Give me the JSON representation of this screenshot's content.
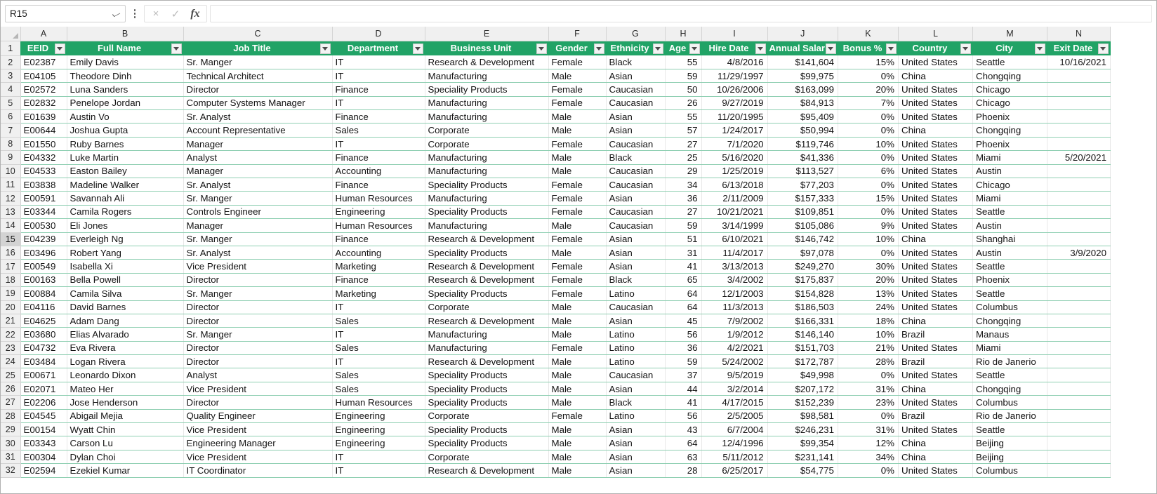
{
  "app": {
    "title": "Excel Worksheet",
    "accent_color": "#21a366",
    "header_text_color": "#ffffff",
    "gridline_color": "#8fcfb2"
  },
  "formula_bar": {
    "name_box_value": "R15",
    "name_box_caret": "chevron-down-icon",
    "more_icon": "kebab-menu-icon",
    "cancel_icon": "×",
    "confirm_icon": "✓",
    "function_icon": "fx",
    "formula_value": ""
  },
  "grid": {
    "column_letters": [
      "A",
      "B",
      "C",
      "D",
      "E",
      "F",
      "G",
      "H",
      "I",
      "J",
      "K",
      "L",
      "M",
      "N"
    ],
    "header_row_number": "1",
    "selected_row": "15",
    "headers": [
      "EEID",
      "Full Name",
      "Job Title",
      "Department",
      "Business Unit",
      "Gender",
      "Ethnicity",
      "Age",
      "Hire Date",
      "Annual Salar",
      "Bonus %",
      "Country",
      "City",
      "Exit Date"
    ],
    "row_numbers": [
      "2",
      "3",
      "4",
      "5",
      "6",
      "7",
      "8",
      "9",
      "10",
      "11",
      "12",
      "13",
      "14",
      "15",
      "16",
      "17",
      "18",
      "19",
      "20",
      "21",
      "22",
      "23",
      "24",
      "25",
      "26",
      "27",
      "28",
      "29",
      "30",
      "31",
      "32"
    ],
    "rows": [
      [
        "E02387",
        "Emily Davis",
        "Sr. Manger",
        "IT",
        "Research & Development",
        "Female",
        "Black",
        "55",
        "4/8/2016",
        "$141,604",
        "15%",
        "United States",
        "Seattle",
        "10/16/2021"
      ],
      [
        "E04105",
        "Theodore Dinh",
        "Technical Architect",
        "IT",
        "Manufacturing",
        "Male",
        "Asian",
        "59",
        "11/29/1997",
        "$99,975",
        "0%",
        "China",
        "Chongqing",
        ""
      ],
      [
        "E02572",
        "Luna Sanders",
        "Director",
        "Finance",
        "Speciality Products",
        "Female",
        "Caucasian",
        "50",
        "10/26/2006",
        "$163,099",
        "20%",
        "United States",
        "Chicago",
        ""
      ],
      [
        "E02832",
        "Penelope Jordan",
        "Computer Systems Manager",
        "IT",
        "Manufacturing",
        "Female",
        "Caucasian",
        "26",
        "9/27/2019",
        "$84,913",
        "7%",
        "United States",
        "Chicago",
        ""
      ],
      [
        "E01639",
        "Austin Vo",
        "Sr. Analyst",
        "Finance",
        "Manufacturing",
        "Male",
        "Asian",
        "55",
        "11/20/1995",
        "$95,409",
        "0%",
        "United States",
        "Phoenix",
        ""
      ],
      [
        "E00644",
        "Joshua Gupta",
        "Account Representative",
        "Sales",
        "Corporate",
        "Male",
        "Asian",
        "57",
        "1/24/2017",
        "$50,994",
        "0%",
        "China",
        "Chongqing",
        ""
      ],
      [
        "E01550",
        "Ruby Barnes",
        "Manager",
        "IT",
        "Corporate",
        "Female",
        "Caucasian",
        "27",
        "7/1/2020",
        "$119,746",
        "10%",
        "United States",
        "Phoenix",
        ""
      ],
      [
        "E04332",
        "Luke Martin",
        "Analyst",
        "Finance",
        "Manufacturing",
        "Male",
        "Black",
        "25",
        "5/16/2020",
        "$41,336",
        "0%",
        "United States",
        "Miami",
        "5/20/2021"
      ],
      [
        "E04533",
        "Easton Bailey",
        "Manager",
        "Accounting",
        "Manufacturing",
        "Male",
        "Caucasian",
        "29",
        "1/25/2019",
        "$113,527",
        "6%",
        "United States",
        "Austin",
        ""
      ],
      [
        "E03838",
        "Madeline Walker",
        "Sr. Analyst",
        "Finance",
        "Speciality Products",
        "Female",
        "Caucasian",
        "34",
        "6/13/2018",
        "$77,203",
        "0%",
        "United States",
        "Chicago",
        ""
      ],
      [
        "E00591",
        "Savannah Ali",
        "Sr. Manger",
        "Human Resources",
        "Manufacturing",
        "Female",
        "Asian",
        "36",
        "2/11/2009",
        "$157,333",
        "15%",
        "United States",
        "Miami",
        ""
      ],
      [
        "E03344",
        "Camila Rogers",
        "Controls Engineer",
        "Engineering",
        "Speciality Products",
        "Female",
        "Caucasian",
        "27",
        "10/21/2021",
        "$109,851",
        "0%",
        "United States",
        "Seattle",
        ""
      ],
      [
        "E00530",
        "Eli Jones",
        "Manager",
        "Human Resources",
        "Manufacturing",
        "Male",
        "Caucasian",
        "59",
        "3/14/1999",
        "$105,086",
        "9%",
        "United States",
        "Austin",
        ""
      ],
      [
        "E04239",
        "Everleigh Ng",
        "Sr. Manger",
        "Finance",
        "Research & Development",
        "Female",
        "Asian",
        "51",
        "6/10/2021",
        "$146,742",
        "10%",
        "China",
        "Shanghai",
        ""
      ],
      [
        "E03496",
        "Robert Yang",
        "Sr. Analyst",
        "Accounting",
        "Speciality Products",
        "Male",
        "Asian",
        "31",
        "11/4/2017",
        "$97,078",
        "0%",
        "United States",
        "Austin",
        "3/9/2020"
      ],
      [
        "E00549",
        "Isabella Xi",
        "Vice President",
        "Marketing",
        "Research & Development",
        "Female",
        "Asian",
        "41",
        "3/13/2013",
        "$249,270",
        "30%",
        "United States",
        "Seattle",
        ""
      ],
      [
        "E00163",
        "Bella Powell",
        "Director",
        "Finance",
        "Research & Development",
        "Female",
        "Black",
        "65",
        "3/4/2002",
        "$175,837",
        "20%",
        "United States",
        "Phoenix",
        ""
      ],
      [
        "E00884",
        "Camila Silva",
        "Sr. Manger",
        "Marketing",
        "Speciality Products",
        "Female",
        "Latino",
        "64",
        "12/1/2003",
        "$154,828",
        "13%",
        "United States",
        "Seattle",
        ""
      ],
      [
        "E04116",
        "David Barnes",
        "Director",
        "IT",
        "Corporate",
        "Male",
        "Caucasian",
        "64",
        "11/3/2013",
        "$186,503",
        "24%",
        "United States",
        "Columbus",
        ""
      ],
      [
        "E04625",
        "Adam Dang",
        "Director",
        "Sales",
        "Research & Development",
        "Male",
        "Asian",
        "45",
        "7/9/2002",
        "$166,331",
        "18%",
        "China",
        "Chongqing",
        ""
      ],
      [
        "E03680",
        "Elias Alvarado",
        "Sr. Manger",
        "IT",
        "Manufacturing",
        "Male",
        "Latino",
        "56",
        "1/9/2012",
        "$146,140",
        "10%",
        "Brazil",
        "Manaus",
        ""
      ],
      [
        "E04732",
        "Eva Rivera",
        "Director",
        "Sales",
        "Manufacturing",
        "Female",
        "Latino",
        "36",
        "4/2/2021",
        "$151,703",
        "21%",
        "United States",
        "Miami",
        ""
      ],
      [
        "E03484",
        "Logan Rivera",
        "Director",
        "IT",
        "Research & Development",
        "Male",
        "Latino",
        "59",
        "5/24/2002",
        "$172,787",
        "28%",
        "Brazil",
        "Rio de Janerio",
        ""
      ],
      [
        "E00671",
        "Leonardo Dixon",
        "Analyst",
        "Sales",
        "Speciality Products",
        "Male",
        "Caucasian",
        "37",
        "9/5/2019",
        "$49,998",
        "0%",
        "United States",
        "Seattle",
        ""
      ],
      [
        "E02071",
        "Mateo Her",
        "Vice President",
        "Sales",
        "Speciality Products",
        "Male",
        "Asian",
        "44",
        "3/2/2014",
        "$207,172",
        "31%",
        "China",
        "Chongqing",
        ""
      ],
      [
        "E02206",
        "Jose Henderson",
        "Director",
        "Human Resources",
        "Speciality Products",
        "Male",
        "Black",
        "41",
        "4/17/2015",
        "$152,239",
        "23%",
        "United States",
        "Columbus",
        ""
      ],
      [
        "E04545",
        "Abigail Mejia",
        "Quality Engineer",
        "Engineering",
        "Corporate",
        "Female",
        "Latino",
        "56",
        "2/5/2005",
        "$98,581",
        "0%",
        "Brazil",
        "Rio de Janerio",
        ""
      ],
      [
        "E00154",
        "Wyatt Chin",
        "Vice President",
        "Engineering",
        "Speciality Products",
        "Male",
        "Asian",
        "43",
        "6/7/2004",
        "$246,231",
        "31%",
        "United States",
        "Seattle",
        ""
      ],
      [
        "E03343",
        "Carson Lu",
        "Engineering Manager",
        "Engineering",
        "Speciality Products",
        "Male",
        "Asian",
        "64",
        "12/4/1996",
        "$99,354",
        "12%",
        "China",
        "Beijing",
        ""
      ],
      [
        "E00304",
        "Dylan Choi",
        "Vice President",
        "IT",
        "Corporate",
        "Male",
        "Asian",
        "63",
        "5/11/2012",
        "$231,141",
        "34%",
        "China",
        "Beijing",
        ""
      ],
      [
        "E02594",
        "Ezekiel Kumar",
        "IT Coordinator",
        "IT",
        "Research & Development",
        "Male",
        "Asian",
        "28",
        "6/25/2017",
        "$54,775",
        "0%",
        "United States",
        "Columbus",
        ""
      ]
    ]
  }
}
